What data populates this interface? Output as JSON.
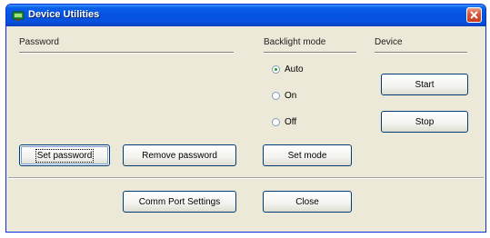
{
  "window": {
    "title": "Device Utilities"
  },
  "icons": {
    "app": "app-icon",
    "close": "close-icon"
  },
  "colors": {
    "title_bar": "#0553e1",
    "close_button": "#d8583a",
    "radio_selected": "#21a121"
  },
  "password": {
    "group_label": "Password",
    "set_button": "Set password",
    "remove_button": "Remove password"
  },
  "backlight": {
    "group_label": "Backlight mode",
    "options": [
      "Auto",
      "On",
      "Off"
    ],
    "selected": "Auto",
    "set_button": "Set mode"
  },
  "device": {
    "group_label": "Device",
    "start_button": "Start",
    "stop_button": "Stop"
  },
  "footer": {
    "comm_button": "Comm Port Settings",
    "close_button": "Close"
  }
}
